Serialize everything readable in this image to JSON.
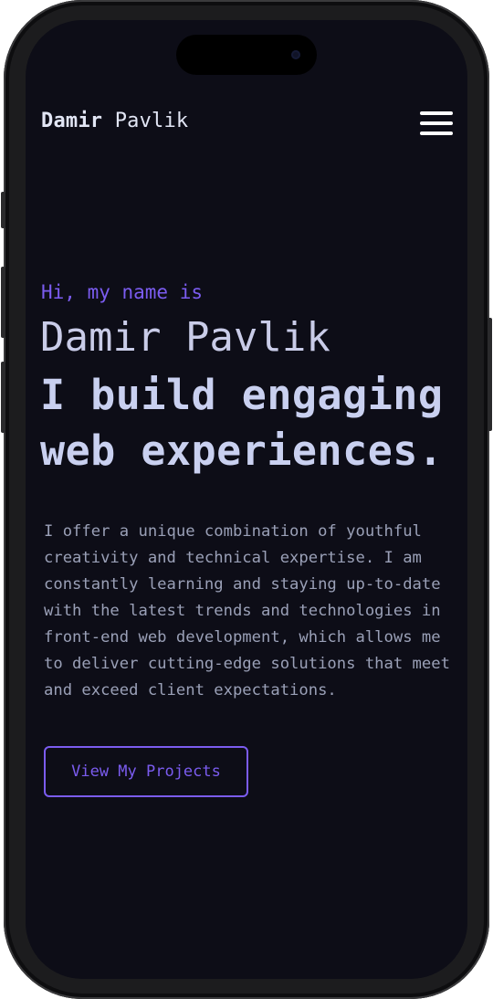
{
  "colors": {
    "background": "#0d0d17",
    "accent": "#7b5cf0",
    "heading": "#c9d0f0",
    "body_text": "#9aa0b7"
  },
  "header": {
    "brand_first": "Damir",
    "brand_last": "Pavlik",
    "menu_icon": "hamburger-menu-icon"
  },
  "hero": {
    "greeting": "Hi, my name is",
    "name": "Damir Pavlik",
    "headline": "I build engaging web experiences.",
    "bio": "I offer a unique combination of youthful creativity and technical expertise. I am constantly learning and staying up-to-date with the latest trends and technologies in front-end web development, which allows me to deliver cutting-edge solutions that meet and exceed client expectations.",
    "cta_label": "View My Projects"
  }
}
